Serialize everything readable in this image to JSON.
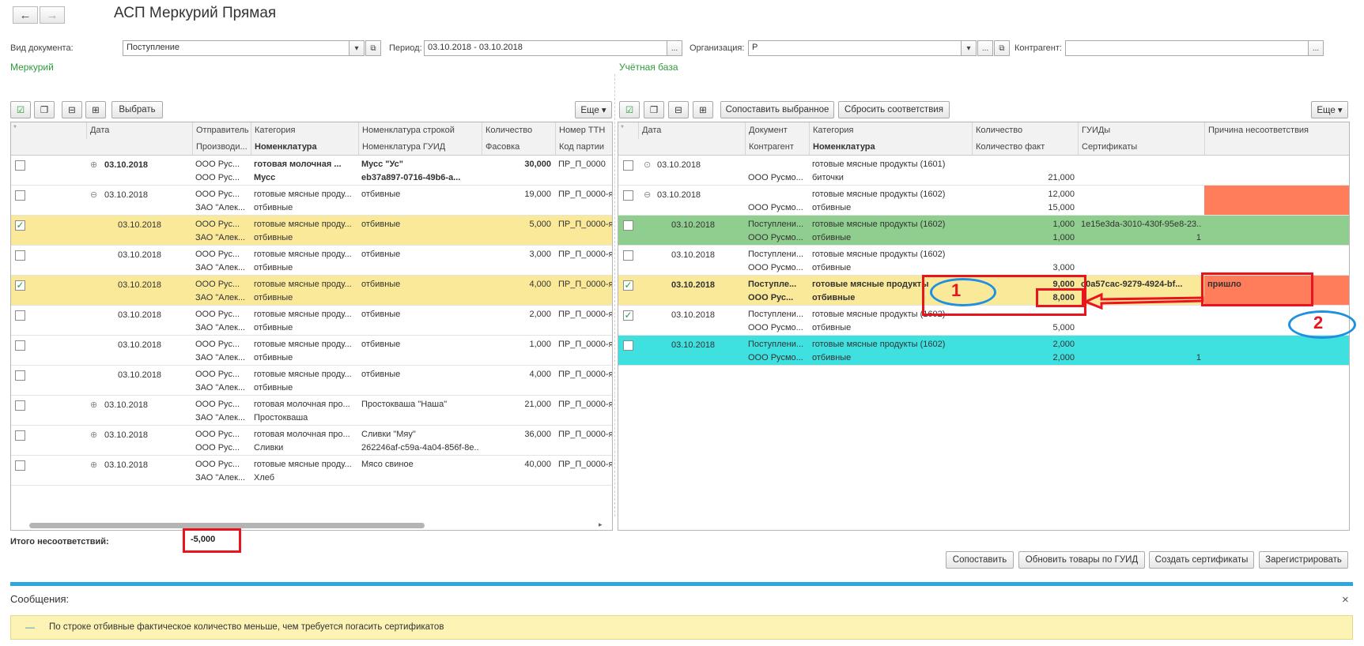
{
  "window": {
    "title": "АСП Меркурий Прямая",
    "back_icon": "←",
    "forward_icon": "→"
  },
  "filters": {
    "doc_type_label": "Вид документа:",
    "doc_type_value": "Поступление",
    "period_label": "Период:",
    "period_value": "03.10.2018 - 03.10.2018",
    "org_label": "Организация:",
    "org_value": "Р",
    "contractor_label": "Контрагент:",
    "contractor_value": "",
    "ellipsis": "...",
    "dropdown": "▾",
    "open": "⧉"
  },
  "left": {
    "section_title": "Меркурий",
    "select_button": "Выбрать",
    "more_button": "Еще ▾",
    "header1": [
      "Дата",
      "Отправитель",
      "Категория",
      "Номенклатура строкой",
      "Количество",
      "Номер ТТН"
    ],
    "header2": [
      "Производи...",
      "Номенклатура",
      "Номенклатура ГУИД",
      "Фасовка",
      "Код партии"
    ],
    "rows": [
      {
        "checked": false,
        "tree": "⊕",
        "date": "03.10.2018",
        "sender": "ООО Рус...",
        "cat": "готовая молочная ...",
        "nom_str": "Мусс \"Ус\"",
        "qty": "30,000",
        "ttn": "ПР_П_0000",
        "prod": "ООО Рус...",
        "nom": "Мусс",
        "guid": "eb37a897-0716-49b6-a...",
        "bold": true,
        "hl": false
      },
      {
        "checked": false,
        "tree": "⊖",
        "date": "03.10.2018",
        "sender": "ООО Рус...",
        "cat": "готовые мясные проду...",
        "nom_str": "отбивные",
        "qty": "19,000",
        "ttn": "ПР_П_0000-я",
        "prod": "ЗАО \"Алек...",
        "nom": "отбивные",
        "guid": "",
        "bold": false,
        "hl": false
      },
      {
        "checked": true,
        "tree": "",
        "date": "03.10.2018",
        "sender": "ООО Рус...",
        "cat": "готовые мясные проду...",
        "nom_str": "отбивные",
        "qty": "5,000",
        "ttn": "ПР_П_0000-я",
        "prod": "ЗАО \"Алек...",
        "nom": "отбивные",
        "guid": "",
        "bold": false,
        "hl": true
      },
      {
        "checked": false,
        "tree": "",
        "date": "03.10.2018",
        "sender": "ООО Рус...",
        "cat": "готовые мясные проду...",
        "nom_str": "отбивные",
        "qty": "3,000",
        "ttn": "ПР_П_0000-я",
        "prod": "ЗАО \"Алек...",
        "nom": "отбивные",
        "guid": "",
        "bold": false,
        "hl": false
      },
      {
        "checked": true,
        "tree": "",
        "date": "03.10.2018",
        "sender": "ООО Рус...",
        "cat": "готовые мясные проду...",
        "nom_str": "отбивные",
        "qty": "4,000",
        "ttn": "ПР_П_0000-я",
        "prod": "ЗАО \"Алек...",
        "nom": "отбивные",
        "guid": "",
        "bold": false,
        "hl": true
      },
      {
        "checked": false,
        "tree": "",
        "date": "03.10.2018",
        "sender": "ООО Рус...",
        "cat": "готовые мясные проду...",
        "nom_str": "отбивные",
        "qty": "2,000",
        "ttn": "ПР_П_0000-я",
        "prod": "ЗАО \"Алек...",
        "nom": "отбивные",
        "guid": "",
        "bold": false,
        "hl": false
      },
      {
        "checked": false,
        "tree": "",
        "date": "03.10.2018",
        "sender": "ООО Рус...",
        "cat": "готовые мясные проду...",
        "nom_str": "отбивные",
        "qty": "1,000",
        "ttn": "ПР_П_0000-я",
        "prod": "ЗАО \"Алек...",
        "nom": "отбивные",
        "guid": "",
        "bold": false,
        "hl": false
      },
      {
        "checked": false,
        "tree": "",
        "date": "03.10.2018",
        "sender": "ООО Рус...",
        "cat": "готовые мясные проду...",
        "nom_str": "отбивные",
        "qty": "4,000",
        "ttn": "ПР_П_0000-я",
        "prod": "ЗАО \"Алек...",
        "nom": "отбивные",
        "guid": "",
        "bold": false,
        "hl": false
      },
      {
        "checked": false,
        "tree": "⊕",
        "date": "03.10.2018",
        "sender": "ООО Рус...",
        "cat": "готовая молочная про...",
        "nom_str": "Простокваша \"Наша\"",
        "qty": "21,000",
        "ttn": "ПР_П_0000-я",
        "prod": "ЗАО \"Алек...",
        "nom": "Простокваша",
        "guid": "",
        "bold": false,
        "hl": false
      },
      {
        "checked": false,
        "tree": "⊕",
        "date": "03.10.2018",
        "sender": "ООО Рус...",
        "cat": "готовая молочная про...",
        "nom_str": "Сливки \"Мяу\"",
        "qty": "36,000",
        "ttn": "ПР_П_0000-я",
        "prod": "ООО Рус...",
        "nom": "Сливки",
        "guid": "262246af-c59a-4a04-856f-8e...",
        "bold": false,
        "hl": false
      },
      {
        "checked": false,
        "tree": "⊕",
        "date": "03.10.2018",
        "sender": "ООО Рус...",
        "cat": "готовые мясные проду...",
        "nom_str": "Мясо свиное",
        "qty": "40,000",
        "ttn": "ПР_П_0000-я",
        "prod": "ЗАО \"Алек...",
        "nom": "Хлеб",
        "guid": "",
        "bold": false,
        "hl": false
      }
    ],
    "total_label": "Итого несоответствий:",
    "total_value": "-5,000"
  },
  "right": {
    "section_title": "Учётная база",
    "match_selected_button": "Сопоставить выбранное",
    "reset_button": "Сбросить соответствия",
    "more_button": "Еще ▾",
    "header1": [
      "Дата",
      "Документ",
      "Категория",
      "Количество",
      "ГУИДы",
      "Причина несоответствия"
    ],
    "header2": [
      "Контрагент",
      "Номенклатура",
      "Количество факт",
      "Сертификаты"
    ],
    "rows": [
      {
        "checked": false,
        "tree": "⊙",
        "date": "03.10.2018",
        "doc": "",
        "cat": "готовые мясные продукты (1601)",
        "qty": "",
        "guid": "",
        "contr": "ООО Русмо...",
        "nom": "биточки",
        "qty_fact": "21,000",
        "cert": "",
        "reason": "",
        "bg": "",
        "bold": false
      },
      {
        "checked": false,
        "tree": "⊖",
        "date": "03.10.2018",
        "doc": "",
        "cat": "готовые мясные продукты (1602)",
        "qty": "12,000",
        "guid": "",
        "contr": "ООО Русмо...",
        "nom": "отбивные",
        "qty_fact": "15,000",
        "cert": "",
        "reason": "",
        "bg": "",
        "bold": false
      },
      {
        "checked": false,
        "tree": "",
        "date": "03.10.2018",
        "doc": "Поступлени...",
        "cat": "готовые мясные продукты (1602)",
        "qty": "1,000",
        "guid": "1e15e3da-3010-430f-95e8-23...",
        "contr": "ООО Русмо...",
        "nom": "отбивные",
        "qty_fact": "1,000",
        "cert": "1",
        "reason": "",
        "bg": "green",
        "bold": false
      },
      {
        "checked": false,
        "tree": "",
        "date": "03.10.2018",
        "doc": "Поступлени...",
        "cat": "готовые мясные продукты (1602)",
        "qty": "",
        "guid": "",
        "contr": "ООО Русмо...",
        "nom": "отбивные",
        "qty_fact": "3,000",
        "cert": "",
        "reason": "",
        "bg": "",
        "bold": false
      },
      {
        "checked": true,
        "tree": "",
        "date": "03.10.2018",
        "doc": "Поступле...",
        "cat": "готовые мясные продукты",
        "qty": "9,000",
        "guid": "c0a57cac-9279-4924-bf...",
        "contr": "ООО Рус...",
        "nom": "отбивные",
        "qty_fact": "8,000",
        "cert": "",
        "reason": "пришло",
        "bg": "yellow",
        "bold": true
      },
      {
        "checked": true,
        "tree": "",
        "date": "03.10.2018",
        "doc": "Поступлени...",
        "cat": "готовые мясные продукты (1602)",
        "qty": "",
        "guid": "",
        "contr": "ООО Русмо...",
        "nom": "отбивные",
        "qty_fact": "5,000",
        "cert": "",
        "reason": "",
        "bg": "",
        "bold": false
      },
      {
        "checked": false,
        "tree": "",
        "date": "03.10.2018",
        "doc": "Поступлени...",
        "cat": "готовые мясные продукты (1602)",
        "qty": "2,000",
        "guid": "",
        "contr": "ООО Русмо...",
        "nom": "отбивные",
        "qty_fact": "2,000",
        "cert": "1",
        "reason": "",
        "bg": "cyan",
        "bold": false
      }
    ]
  },
  "bottom_buttons": [
    "Сопоставить",
    "Обновить товары по ГУИД",
    "Создать сертификаты",
    "Зарегистрировать"
  ],
  "messages": {
    "title": "Сообщения:",
    "close": "×",
    "dash": "—",
    "text": "По строке отбивные фактическое количество меньше, чем требуется погасить сертификатов"
  },
  "annotations": {
    "label1": "1",
    "label2": "2"
  },
  "colors": {
    "row_yellow": "#fbe99a",
    "row_green": "#8fce8f",
    "row_cyan": "#3ee0e0",
    "reason_red": "#ff7d5a",
    "annotation_red": "#e8141e",
    "annotation_blue": "#1e90e0",
    "accent_blue": "#2da7e0"
  }
}
